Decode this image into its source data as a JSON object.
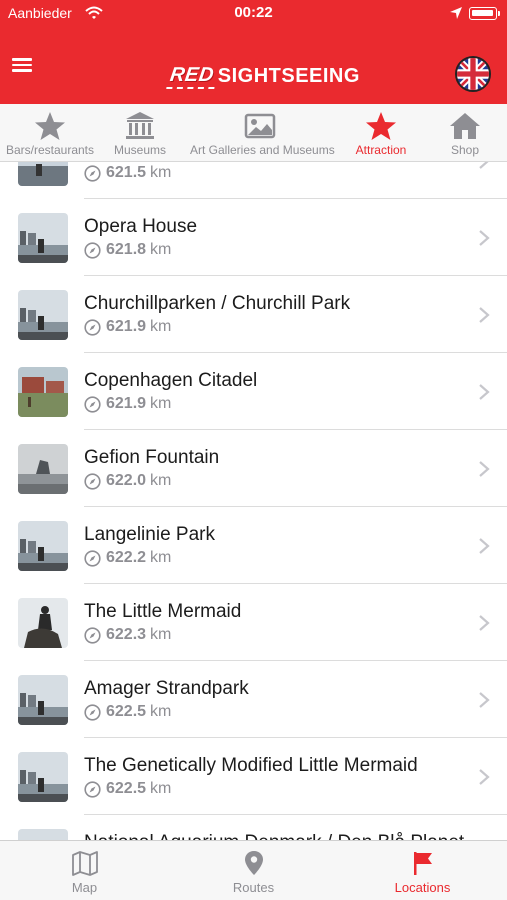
{
  "status_bar": {
    "carrier": "Aanbieder",
    "time": "00:22"
  },
  "header": {
    "logo_red": "RED",
    "logo_rest": "SIGHTSEEING",
    "language": "English"
  },
  "categories": [
    {
      "label": "Bars/restaurants",
      "icon": "star-icon"
    },
    {
      "label": "Museums",
      "icon": "museum-icon"
    },
    {
      "label": "Art Galleries and Museums",
      "icon": "picture-icon"
    },
    {
      "label": "Attraction",
      "icon": "star-icon",
      "active": true
    },
    {
      "label": "Shop",
      "icon": "home-icon"
    }
  ],
  "list": {
    "unit": "km",
    "items": [
      {
        "title": "",
        "distance": "621.5"
      },
      {
        "title": "Opera House",
        "distance": "621.8"
      },
      {
        "title": "Churchillparken / Churchill Park",
        "distance": "621.9"
      },
      {
        "title": "Copenhagen Citadel",
        "distance": "621.9"
      },
      {
        "title": "Gefion Fountain",
        "distance": "622.0"
      },
      {
        "title": "Langelinie Park",
        "distance": "622.2"
      },
      {
        "title": "The Little Mermaid",
        "distance": "622.3"
      },
      {
        "title": "Amager Strandpark",
        "distance": "622.5"
      },
      {
        "title": "The Genetically Modified Little Mermaid",
        "distance": "622.5"
      },
      {
        "title": "National Aquarium Denmark / Den Blå Planet",
        "distance": ""
      }
    ]
  },
  "tabbar": [
    {
      "label": "Map",
      "icon": "map-icon"
    },
    {
      "label": "Routes",
      "icon": "pin-icon"
    },
    {
      "label": "Locations",
      "icon": "flag-icon",
      "active": true
    }
  ],
  "colors": {
    "brand_red": "#ea2a2f",
    "inactive_gray": "#8e8e93"
  }
}
